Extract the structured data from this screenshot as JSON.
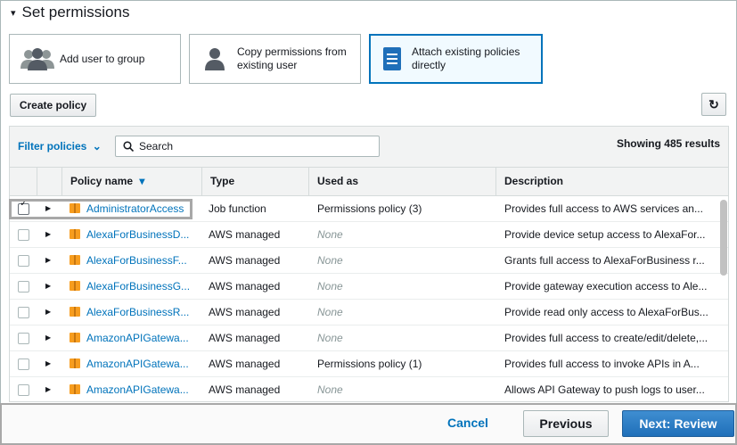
{
  "section": {
    "caret": "▾",
    "title": "Set permissions"
  },
  "options": {
    "add_to_group": "Add user to group",
    "copy_line1": "Copy permissions from",
    "copy_line2": "existing user",
    "attach_line1": "Attach existing policies",
    "attach_line2": "directly",
    "selected": "attach_existing_policies"
  },
  "toolbar": {
    "create_policy": "Create policy",
    "refresh_icon": "↻"
  },
  "filter": {
    "label": "Filter policies",
    "chevron": "⌄",
    "search_placeholder": "Search",
    "showing": "Showing 485 results"
  },
  "table": {
    "columns": {
      "name": "Policy name",
      "sort": "▾",
      "type": "Type",
      "used_as": "Used as",
      "description": "Description"
    },
    "rows": [
      {
        "checked": true,
        "name": "AdministratorAccess",
        "type": "Job function",
        "used_as": "Permissions policy (3)",
        "used_none": false,
        "description": "Provides full access to AWS services an..."
      },
      {
        "checked": false,
        "name": "AlexaForBusinessD...",
        "type": "AWS managed",
        "used_as": "None",
        "used_none": true,
        "description": "Provide device setup access to AlexaFor..."
      },
      {
        "checked": false,
        "name": "AlexaForBusinessF...",
        "type": "AWS managed",
        "used_as": "None",
        "used_none": true,
        "description": "Grants full access to AlexaForBusiness r..."
      },
      {
        "checked": false,
        "name": "AlexaForBusinessG...",
        "type": "AWS managed",
        "used_as": "None",
        "used_none": true,
        "description": "Provide gateway execution access to Ale..."
      },
      {
        "checked": false,
        "name": "AlexaForBusinessR...",
        "type": "AWS managed",
        "used_as": "None",
        "used_none": true,
        "description": "Provide read only access to AlexaForBus..."
      },
      {
        "checked": false,
        "name": "AmazonAPIGatewa...",
        "type": "AWS managed",
        "used_as": "None",
        "used_none": true,
        "description": "Provides full access to create/edit/delete,..."
      },
      {
        "checked": false,
        "name": "AmazonAPIGatewa...",
        "type": "AWS managed",
        "used_as": "Permissions policy (1)",
        "used_none": false,
        "description": "Provides full access to invoke APIs in A..."
      },
      {
        "checked": false,
        "name": "AmazonAPIGatewa...",
        "type": "AWS managed",
        "used_as": "None",
        "used_none": true,
        "description": "Allows API Gateway to push logs to user..."
      }
    ]
  },
  "footer": {
    "cancel": "Cancel",
    "previous": "Previous",
    "next": "Next: Review"
  },
  "colors": {
    "accent": "#0073bb",
    "primary_button": "#2e7fc6",
    "policy_icon": "#f79d1f"
  }
}
